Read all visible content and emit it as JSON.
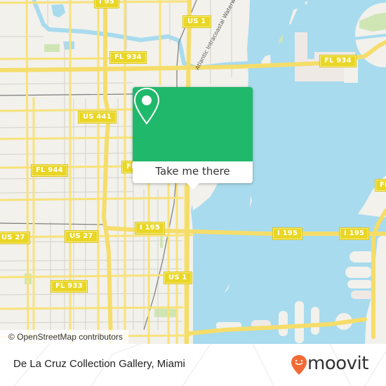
{
  "map": {
    "colors": {
      "land": "#f2f1ec",
      "water": "#a8dbee",
      "road_major": "#f7e27a",
      "road_minor": "#d0cdc6",
      "park": "#cfe6b4",
      "rail": "#777777"
    },
    "road_shields": [
      {
        "id": "i95",
        "label": "I 95"
      },
      {
        "id": "us1-north",
        "label": "US 1"
      },
      {
        "id": "fl934-west",
        "label": "FL 934"
      },
      {
        "id": "fl934-east",
        "label": "FL 934"
      },
      {
        "id": "us441",
        "label": "US 441"
      },
      {
        "id": "fl944",
        "label": "FL 944"
      },
      {
        "id": "fl-partial",
        "label": "FL"
      },
      {
        "id": "fl-partial-east",
        "label": "FL"
      },
      {
        "id": "us27-west",
        "label": "US 27"
      },
      {
        "id": "us27-center",
        "label": "US 27"
      },
      {
        "id": "i195-west",
        "label": "I 195"
      },
      {
        "id": "i195-center",
        "label": "I 195"
      },
      {
        "id": "i195-east",
        "label": "I 195"
      },
      {
        "id": "us1-south",
        "label": "US 1"
      },
      {
        "id": "fl933",
        "label": "FL 933"
      }
    ],
    "waterway_label": "Atlantic Intracoastal Waterway",
    "attribution": "© OpenStreetMap contributors"
  },
  "popup": {
    "icon": "map-pin-icon",
    "button_label": "Take me there",
    "header_color": "#20b86b"
  },
  "footer": {
    "place_name": "De La Cruz Collection Gallery, Miami",
    "brand_name": "moovit",
    "brand_color": "#f26a36"
  }
}
